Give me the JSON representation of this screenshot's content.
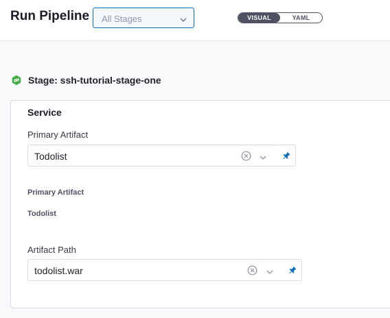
{
  "header": {
    "title": "Run Pipeline",
    "stage_select": {
      "value": "All Stages"
    },
    "view_toggle": {
      "visual_label": "VISUAL",
      "yaml_label": "YAML",
      "active": "VISUAL"
    }
  },
  "stage": {
    "label": "Stage: ssh-tutorial-stage-one",
    "icon": "stage-link-icon"
  },
  "service": {
    "title": "Service",
    "primary_artifact": {
      "label": "Primary Artifact",
      "value": "Todolist",
      "icons": [
        "clear-icon",
        "chevron-down-icon",
        "pin-icon"
      ]
    },
    "summary": {
      "label": "Primary Artifact",
      "value": "Todolist"
    },
    "artifact_path": {
      "label": "Artifact Path",
      "value": "todolist.war",
      "icons": [
        "clear-icon",
        "chevron-down-icon",
        "pin-icon"
      ]
    }
  },
  "colors": {
    "accent": "#0a6ebd",
    "stage_icon": "#42ab45",
    "toggle_active": "#4f5162"
  }
}
